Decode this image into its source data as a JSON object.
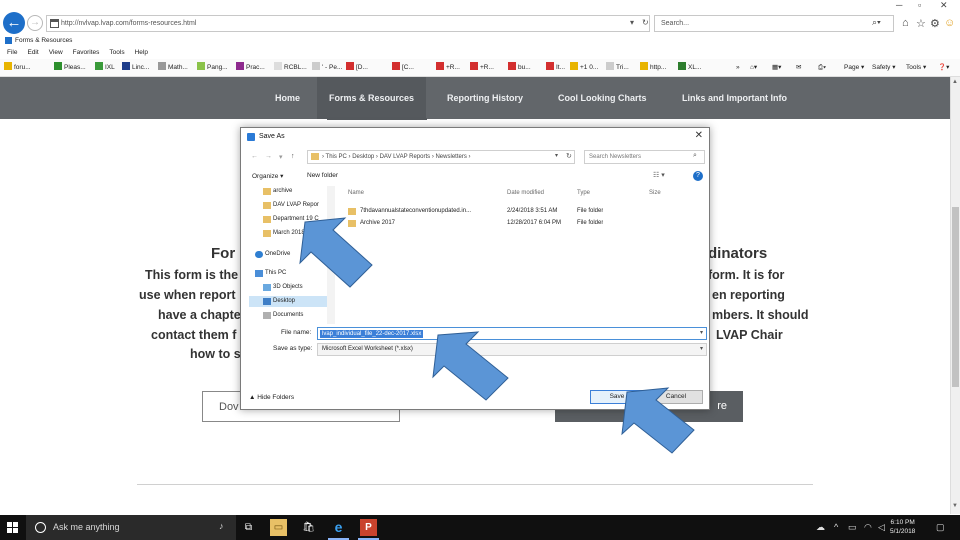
{
  "browser": {
    "url": "http://nvlvap.lvap.com/forms-resources.html",
    "search_placeholder": "Search...",
    "tab_label": "Forms & Resources",
    "menu": [
      "File",
      "Edit",
      "View",
      "Favorites",
      "Tools",
      "Help"
    ],
    "favorites": [
      "foru...",
      "Pleas...",
      "IXL",
      "Linc...",
      "Math...",
      "Pang...",
      "Prac...",
      "RCBL...",
      "' - Pe...",
      "[D...",
      "[C...",
      "+R...",
      "+R...",
      "bu...",
      "It...",
      "+1 0...",
      "Tri...",
      "http...",
      "XL..."
    ],
    "command_items": [
      "Page",
      "Safety",
      "Tools"
    ]
  },
  "site": {
    "nav": [
      "Home",
      "Forms & Resources",
      "Reporting History",
      "Cool Looking Charts",
      "Links and Important Info"
    ],
    "heading_left": "For",
    "heading_right": "dinators",
    "para_left": [
      "This form is the",
      "use when report",
      "have a chapte",
      "contact them f",
      "how to s"
    ],
    "para_right": [
      "form.  It is for",
      "en reporting",
      "mbers.  It should",
      "LVAP Chair"
    ],
    "download_btn": "Dov",
    "dark_btn": "re"
  },
  "dialog": {
    "title": "Save As",
    "breadcrumb": "›  This PC  ›  Desktop  ›  DAV LVAP Reports  ›  Newsletters  ›",
    "search_placeholder": "Search Newsletters",
    "organize": "Organize ▾",
    "new_folder": "New folder",
    "tree": [
      {
        "label": "archive",
        "icon": "folder"
      },
      {
        "label": "DAV LVAP Repor",
        "icon": "folder"
      },
      {
        "label": "Department 19 C",
        "icon": "folder"
      },
      {
        "label": "March 2018",
        "icon": "folder"
      },
      {
        "label": "OneDrive",
        "icon": "cloud"
      },
      {
        "label": "This PC",
        "icon": "pc"
      },
      {
        "label": "3D Objects",
        "icon": "3d"
      },
      {
        "label": "Desktop",
        "icon": "desktop"
      },
      {
        "label": "Documents",
        "icon": "doc"
      }
    ],
    "columns": [
      "Name",
      "Date modified",
      "Type",
      "Size"
    ],
    "files": [
      {
        "name": "7thdavannualstateconventionupdated.in...",
        "date": "2/24/2018 3:51 AM",
        "type": "File folder"
      },
      {
        "name": "Archive 2017",
        "date": "12/28/2017 6:04 PM",
        "type": "File folder"
      }
    ],
    "file_name_label": "File name:",
    "file_name_value": "lvap_individual_file_22-dec-2017.xlsx",
    "save_type_label": "Save as type:",
    "save_type_value": "Microsoft Excel Worksheet (*.xlsx)",
    "hide_folders": "▲ Hide Folders",
    "save_btn": "Save",
    "cancel_btn": "Cancel"
  },
  "taskbar": {
    "search_text": "Ask me anything",
    "time": "6:10 PM",
    "date": "5/1/2018"
  }
}
